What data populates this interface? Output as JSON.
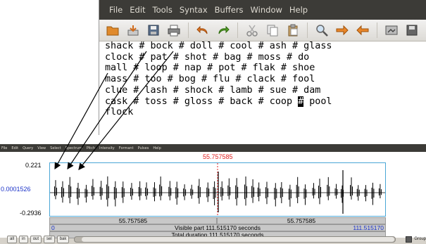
{
  "vim": {
    "menu": [
      "File",
      "Edit",
      "Tools",
      "Syntax",
      "Buffers",
      "Window",
      "Help"
    ],
    "toolbar_icons": [
      "open-folder-icon",
      "save-down-icon",
      "save-icon",
      "print-icon",
      "undo-icon",
      "redo-icon",
      "cut-icon",
      "copy-icon",
      "paste-icon",
      "find-replace-icon",
      "forward-arrow-icon",
      "back-arrow-icon",
      "load-session-icon",
      "save-session-icon"
    ],
    "lines": [
      "shack # bock # doll # cool # ash # glass",
      "clock # pat # shot # bag # moss # do",
      "mall # loop # nap # pot # flak # shoe",
      "mass # too # bog # flu # clack # fool",
      "clue # lash # shock # lamb # sue # dam",
      "cask # toss # gloss # back # coop ",
      "flock"
    ],
    "cursor_char": "#",
    "line6_tail": " pool"
  },
  "praat": {
    "menu": [
      "File",
      "Edit",
      "Query",
      "View",
      "Select",
      "Spectrum",
      "Pitch",
      "Intensity",
      "Formant",
      "Pulses",
      "Help"
    ],
    "cursor_time": "55.757585",
    "y_max": "0.221",
    "y_cursor": "0.0001526",
    "y_min": "-0.2936",
    "segment_left": "55.757585",
    "segment_right": "55.757585",
    "visible_start": "0",
    "visible_label": "Visible part 111.515170 seconds",
    "visible_end": "111.515170",
    "total_label": "Total duration 111.515170 seconds",
    "buttons": [
      "all",
      "in",
      "out",
      "sel",
      "bak"
    ],
    "group_label": "Group",
    "waveform_color": "#000000",
    "cursor_color": "#e02020"
  }
}
